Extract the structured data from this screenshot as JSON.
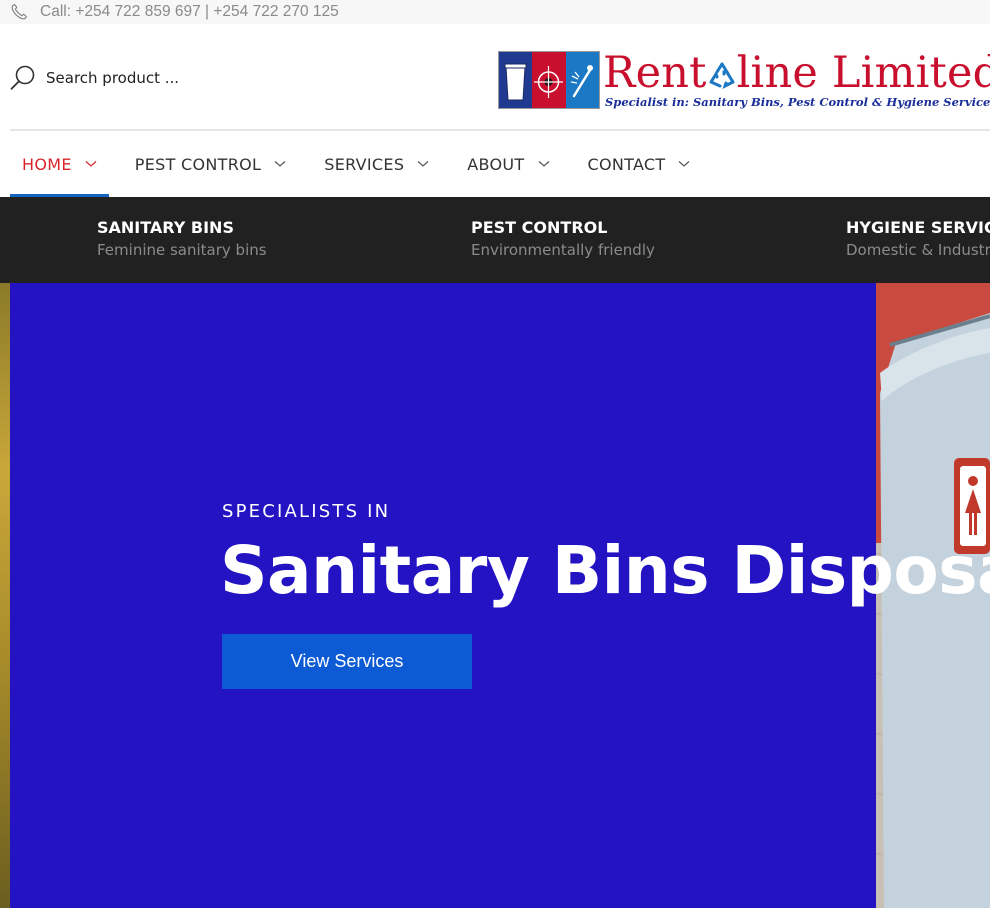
{
  "topbar": {
    "call_text": "Call: +254 722 859 697 | +254 722 270 125",
    "icon": "phone-icon"
  },
  "header": {
    "search": {
      "placeholder": "Search product ...",
      "icon": "search-icon"
    },
    "logo": {
      "name_part1": "Rent",
      "name_part2": "line Limited",
      "tagline": "Specialist in: Sanitary Bins, Pest Control & Hygiene Services",
      "brand_color": "#c8102e",
      "tagline_color": "#1a2e9a"
    }
  },
  "nav": {
    "items": [
      {
        "label": "HOME",
        "active": true
      },
      {
        "label": "PEST CONTROL",
        "active": false
      },
      {
        "label": "SERVICES",
        "active": false
      },
      {
        "label": "ABOUT",
        "active": false
      },
      {
        "label": "CONTACT",
        "active": false
      }
    ],
    "active_color": "#d8242a",
    "underline_color": "#1565c0"
  },
  "features": [
    {
      "title": "SANITARY BINS",
      "subtitle": "Feminine sanitary bins"
    },
    {
      "title": "PEST CONTROL",
      "subtitle": "Environmentally friendly"
    },
    {
      "title": "HYGIENE SERVICES",
      "subtitle": "Domestic & Industrial"
    }
  ],
  "hero": {
    "kicker": "SPECIALISTS IN",
    "title": "Sanitary Bins Disposal",
    "button_label": "View Services",
    "panel_color": "#2313c2",
    "button_color": "#0d5bd4"
  }
}
